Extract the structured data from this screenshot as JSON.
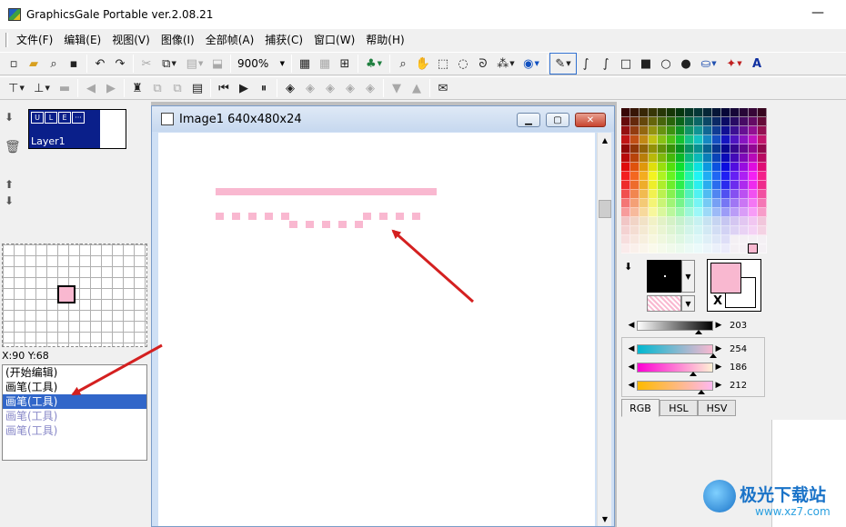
{
  "window": {
    "title": "GraphicsGale Portable ver.2.08.21",
    "minimize_glyph": "—"
  },
  "menu": [
    "文件(F)",
    "编辑(E)",
    "视图(V)",
    "图像(I)",
    "全部帧(A)",
    "捕获(C)",
    "窗口(W)",
    "帮助(H)"
  ],
  "toolbar": {
    "zoom": "900%"
  },
  "layers": {
    "name": "Layer1",
    "btn_u": "U",
    "btn_l": "L",
    "btn_e": "E",
    "btn_more": "···"
  },
  "preview": {
    "coords": "X:90 Y:68"
  },
  "history": [
    {
      "label": "(开始编辑)",
      "state": "normal"
    },
    {
      "label": "画笔(工具)",
      "state": "normal"
    },
    {
      "label": "画笔(工具)",
      "state": "selected"
    },
    {
      "label": "画笔(工具)",
      "state": "undone"
    },
    {
      "label": "画笔(工具)",
      "state": "undone"
    }
  ],
  "image_window": {
    "title": "Image1 640x480x24"
  },
  "colors": {
    "foreground": "#f9b8d0",
    "background": "#ffffff",
    "swap_label": "X"
  },
  "sliders": {
    "gray": {
      "value": "203",
      "fraction": 0.8
    },
    "r": {
      "value": "254",
      "fraction": 0.99
    },
    "g": {
      "value": "186",
      "fraction": 0.73
    },
    "b": {
      "value": "212",
      "fraction": 0.83
    }
  },
  "tabs": [
    "RGB",
    "HSL",
    "HSV"
  ],
  "watermark": {
    "brand": "极光下载站",
    "url": "www.xz7.com"
  }
}
